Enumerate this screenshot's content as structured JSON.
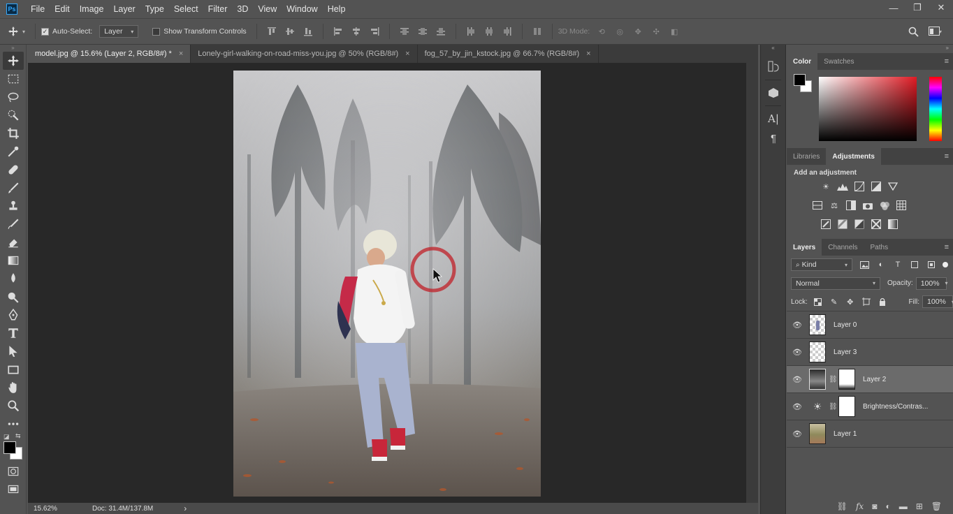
{
  "app": {
    "logo": "Ps"
  },
  "menu": [
    "File",
    "Edit",
    "Image",
    "Layer",
    "Type",
    "Select",
    "Filter",
    "3D",
    "View",
    "Window",
    "Help"
  ],
  "window_controls": {
    "minimize": "—",
    "restore": "❐",
    "close": "✕"
  },
  "options": {
    "auto_select_label": "Auto-Select:",
    "auto_select_checked": true,
    "auto_select_target": "Layer",
    "show_transform_label": "Show Transform Controls",
    "show_transform_checked": false,
    "mode_3d_label": "3D Mode:"
  },
  "tabs": [
    {
      "title": "model.jpg @ 15.6% (Layer 2, RGB/8#) *",
      "active": true
    },
    {
      "title": "Lonely-girl-walking-on-road-miss-you.jpg @ 50% (RGB/8#)",
      "active": false
    },
    {
      "title": "fog_57_by_jin_kstock.jpg @ 66.7% (RGB/8#)",
      "active": false
    }
  ],
  "tab_close": "×",
  "status": {
    "zoom": "15.62%",
    "doc": "Doc: 31.4M/137.8M",
    "arrow": "›"
  },
  "color_panel": {
    "tabs": [
      "Color",
      "Swatches"
    ],
    "foreground": "#000000",
    "background": "#ffffff",
    "hue_color": "#e01b24"
  },
  "adjustments_panel": {
    "tabs": [
      "Libraries",
      "Adjustments"
    ],
    "heading": "Add an adjustment"
  },
  "layers_panel": {
    "tabs": [
      "Layers",
      "Channels",
      "Paths"
    ],
    "filter_kind": "Kind",
    "blend_mode": "Normal",
    "opacity_label": "Opacity:",
    "opacity": "100%",
    "lock_label": "Lock:",
    "fill_label": "Fill:",
    "fill": "100%",
    "layers": [
      {
        "name": "Layer 0",
        "selected": false
      },
      {
        "name": "Layer 3",
        "selected": false
      },
      {
        "name": "Layer 2",
        "selected": true
      },
      {
        "name": "Brightness/Contras...",
        "selected": false
      },
      {
        "name": "Layer 1",
        "selected": false
      }
    ]
  },
  "panel_menu_glyph": "≡",
  "collapse_glyph": "»",
  "expand_glyph": "«"
}
